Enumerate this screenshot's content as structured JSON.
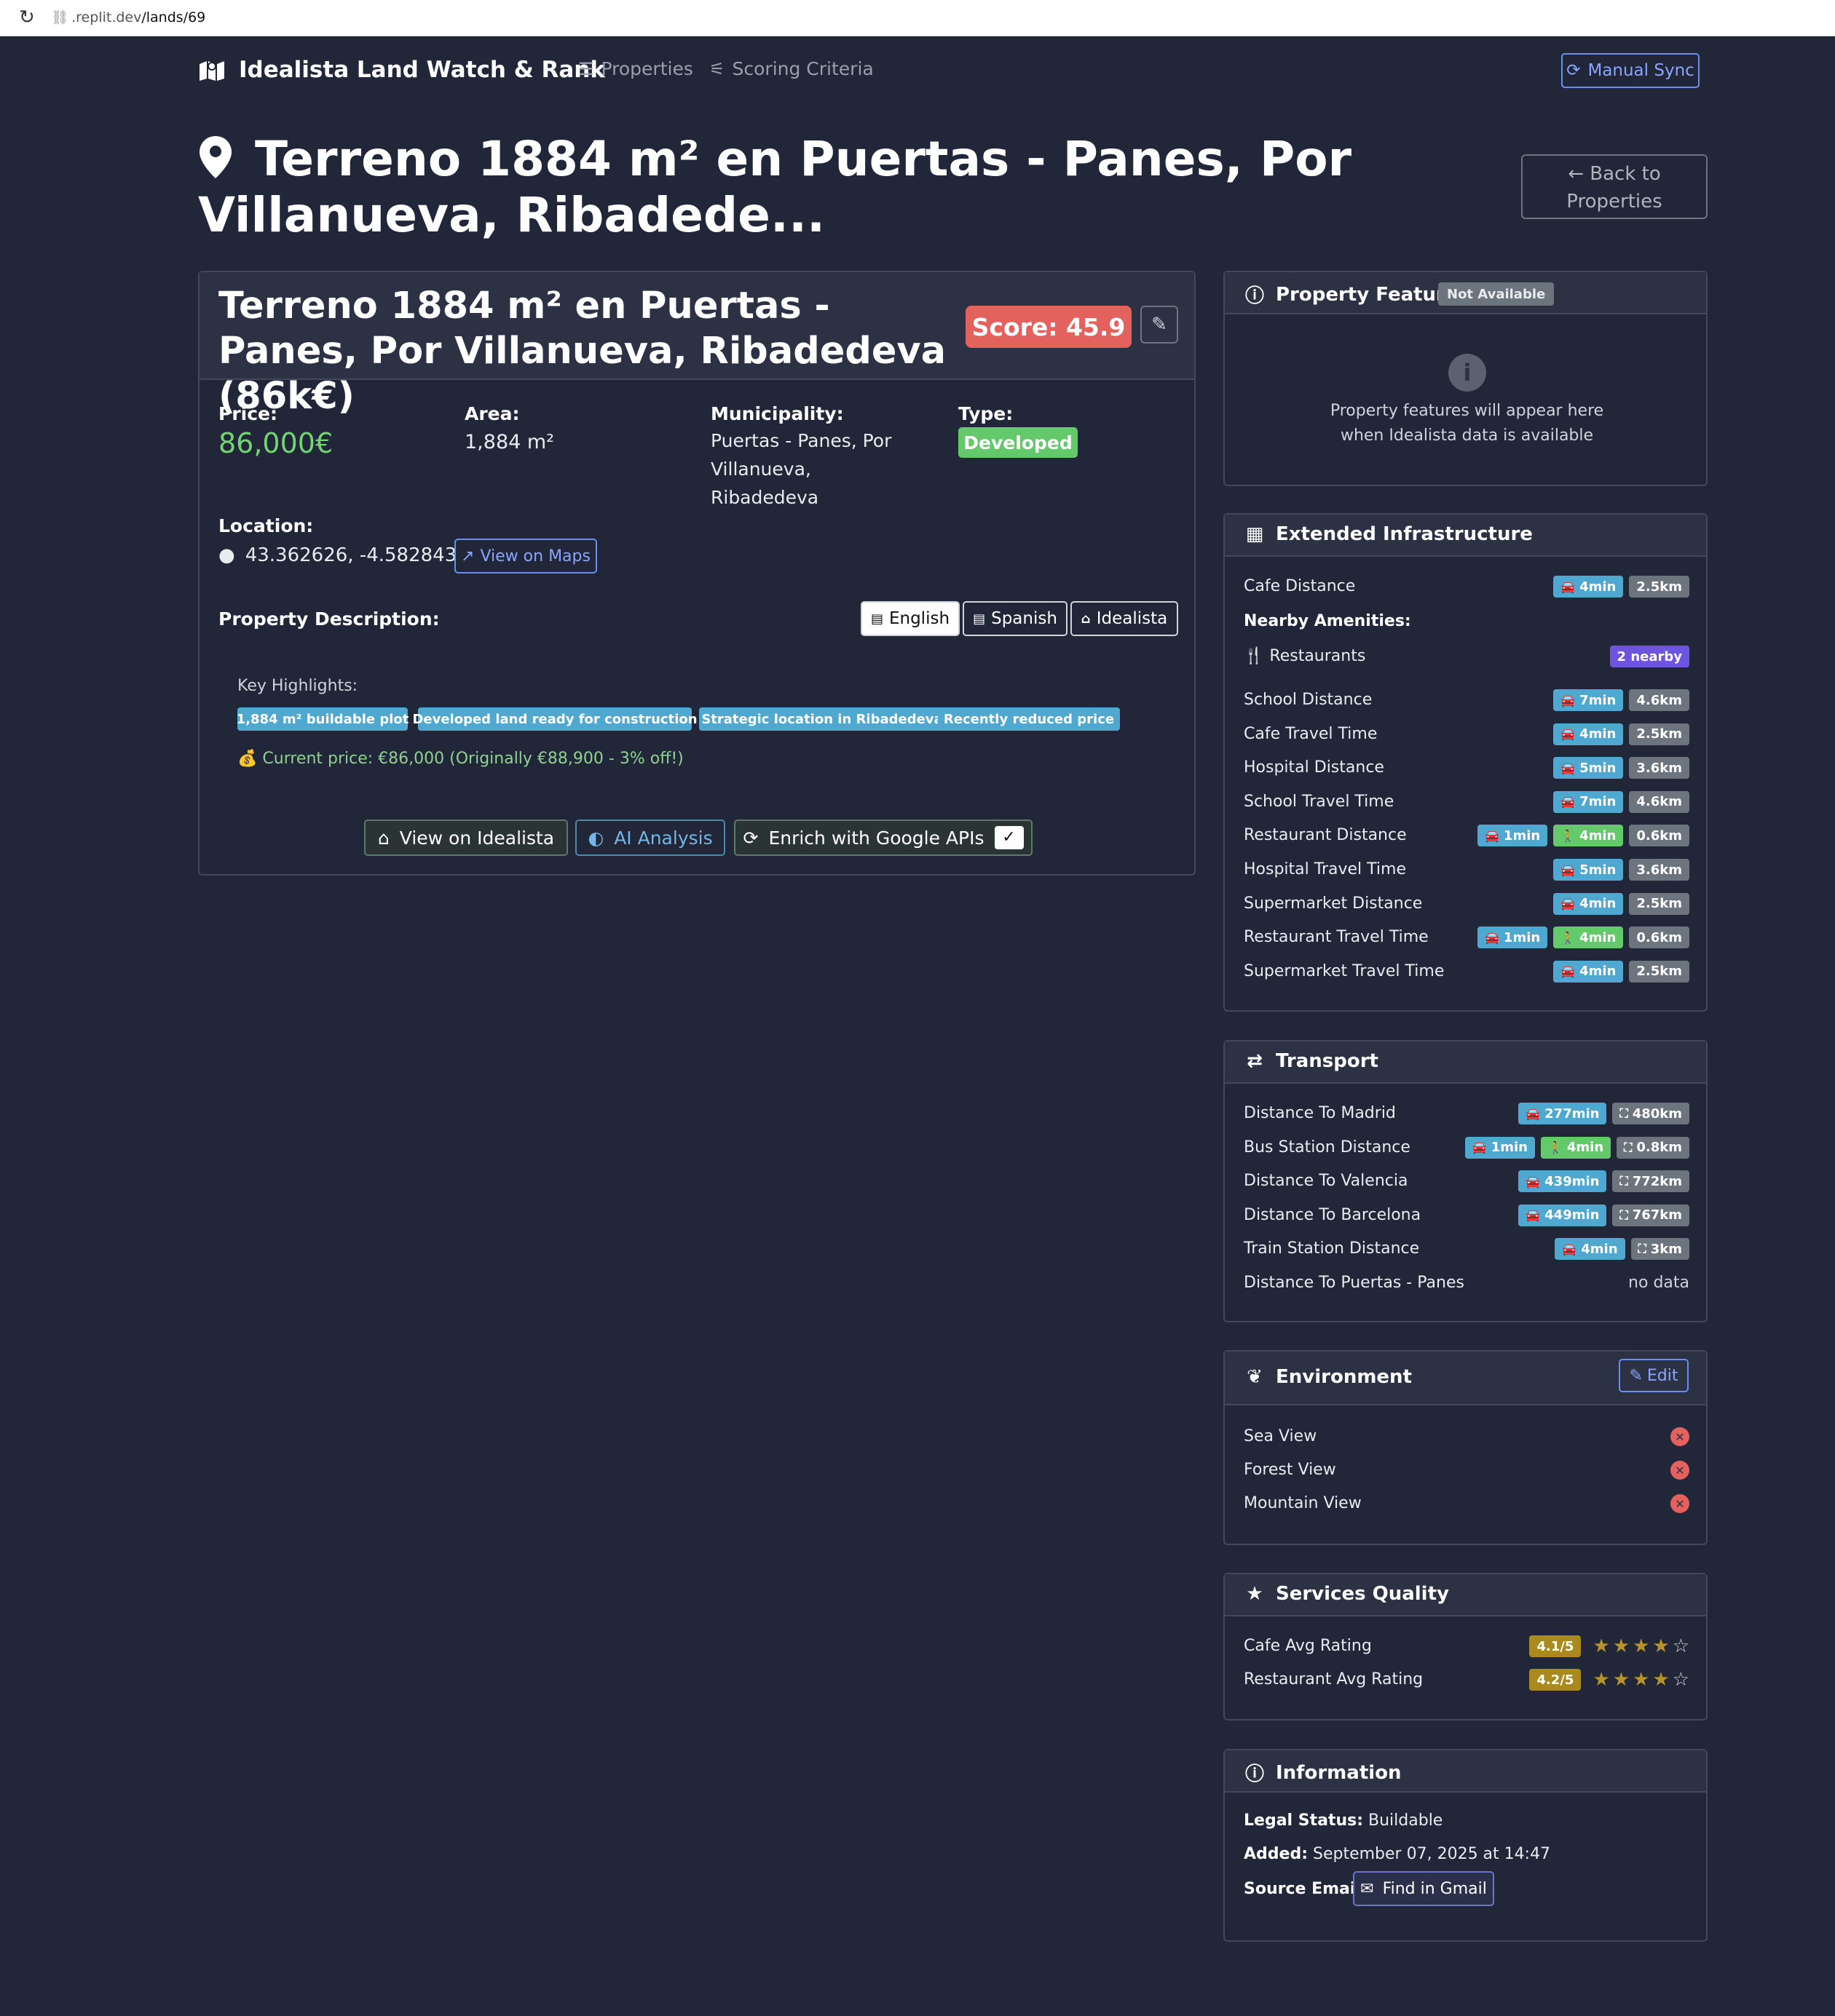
{
  "browser": {
    "url_host": ".replit.dev",
    "url_path": "/lands/69"
  },
  "nav": {
    "brand": "Idealista Land Watch & Rank",
    "links": [
      "Properties",
      "Scoring Criteria"
    ],
    "sync_label": "Manual Sync"
  },
  "page": {
    "title": "Terreno 1884 m² en Puertas - Panes, Por Villanueva, Ribadede...",
    "back_label": "Back to Properties"
  },
  "property": {
    "title": "Terreno 1884 m² en Puertas - Panes, Por Villanueva, Ribadedeva (86k€)",
    "score": "Score: 45.9",
    "price_label": "Price:",
    "price": "86,000€",
    "area_label": "Area:",
    "area": "1,884 m²",
    "municipality_label": "Municipality:",
    "municipality": "Puertas - Panes, Por Villanueva, Ribadedeva",
    "type_label": "Type:",
    "type": "Developed",
    "location_label": "Location:",
    "coords": "43.362626, -4.582843",
    "maps_label": "View on Maps",
    "description_label": "Property Description:",
    "languages": [
      "English",
      "Spanish",
      "Idealista"
    ],
    "highlights_label": "Key Highlights:",
    "highlights": [
      "1,884 m² buildable plot",
      "Developed land ready for construction",
      "Strategic location in Ribadedeva",
      "Recently reduced price"
    ],
    "price_note": "Current price: €86,000 (Originally €88,900 - 3% off!)",
    "actions": {
      "idealista": "View on Idealista",
      "ai": "AI Analysis",
      "enrich": "Enrich with Google APIs",
      "check": "✓"
    }
  },
  "features": {
    "title": "Property Features",
    "badge": "Not Available",
    "message_1": "Property features will appear here",
    "message_2": "when Idealista data is available"
  },
  "infrastructure": {
    "title": "Extended Infrastructure",
    "nearby_label": "Nearby Amenities:",
    "restaurants_label": "Restaurants",
    "restaurants_badge": "2 nearby",
    "rows": [
      {
        "label": "Cafe Distance",
        "car": "4min",
        "walk": "",
        "km": "2.5km"
      },
      {
        "label": "School Distance",
        "car": "7min",
        "walk": "",
        "km": "4.6km"
      },
      {
        "label": "Cafe Travel Time",
        "car": "4min",
        "walk": "",
        "km": "2.5km"
      },
      {
        "label": "Hospital Distance",
        "car": "5min",
        "walk": "",
        "km": "3.6km"
      },
      {
        "label": "School Travel Time",
        "car": "7min",
        "walk": "",
        "km": "4.6km"
      },
      {
        "label": "Restaurant Distance",
        "car": "1min",
        "walk": "4min",
        "km": "0.6km"
      },
      {
        "label": "Hospital Travel Time",
        "car": "5min",
        "walk": "",
        "km": "3.6km"
      },
      {
        "label": "Supermarket Distance",
        "car": "4min",
        "walk": "",
        "km": "2.5km"
      },
      {
        "label": "Restaurant Travel Time",
        "car": "1min",
        "walk": "4min",
        "km": "0.6km"
      },
      {
        "label": "Supermarket Travel Time",
        "car": "4min",
        "walk": "",
        "km": "2.5km"
      }
    ]
  },
  "transport": {
    "title": "Transport",
    "rows": [
      {
        "label": "Distance To Madrid",
        "car": "277min",
        "walk": "",
        "km": "480km"
      },
      {
        "label": "Bus Station Distance",
        "car": "1min",
        "walk": "4min",
        "km": "0.8km"
      },
      {
        "label": "Distance To Valencia",
        "car": "439min",
        "walk": "",
        "km": "772km"
      },
      {
        "label": "Distance To Barcelona",
        "car": "449min",
        "walk": "",
        "km": "767km"
      },
      {
        "label": "Train Station Distance",
        "car": "4min",
        "walk": "",
        "km": "3km"
      }
    ],
    "last_label": "Distance To Puertas - Panes",
    "last_value": "no data"
  },
  "environment": {
    "title": "Environment",
    "edit_label": "Edit",
    "views": [
      "Sea View",
      "Forest View",
      "Mountain View"
    ]
  },
  "services": {
    "title": "Services Quality",
    "rows": [
      {
        "label": "Cafe Avg Rating",
        "rating": "4.1/5",
        "stars": 4
      },
      {
        "label": "Restaurant Avg Rating",
        "rating": "4.2/5",
        "stars": 4
      }
    ]
  },
  "information": {
    "title": "Information",
    "legal_label": "Legal Status:",
    "legal_value": "Buildable",
    "added_label": "Added:",
    "added_value": "September 07, 2025 at 14:47",
    "email_label": "Source Email:",
    "gmail_label": "Find in Gmail"
  },
  "colors": {
    "background": "#222639",
    "score": "#e3625e",
    "type": "#63c96a",
    "car": "#4fa8cf",
    "walk": "#63c96a",
    "km": "#6c757d"
  }
}
